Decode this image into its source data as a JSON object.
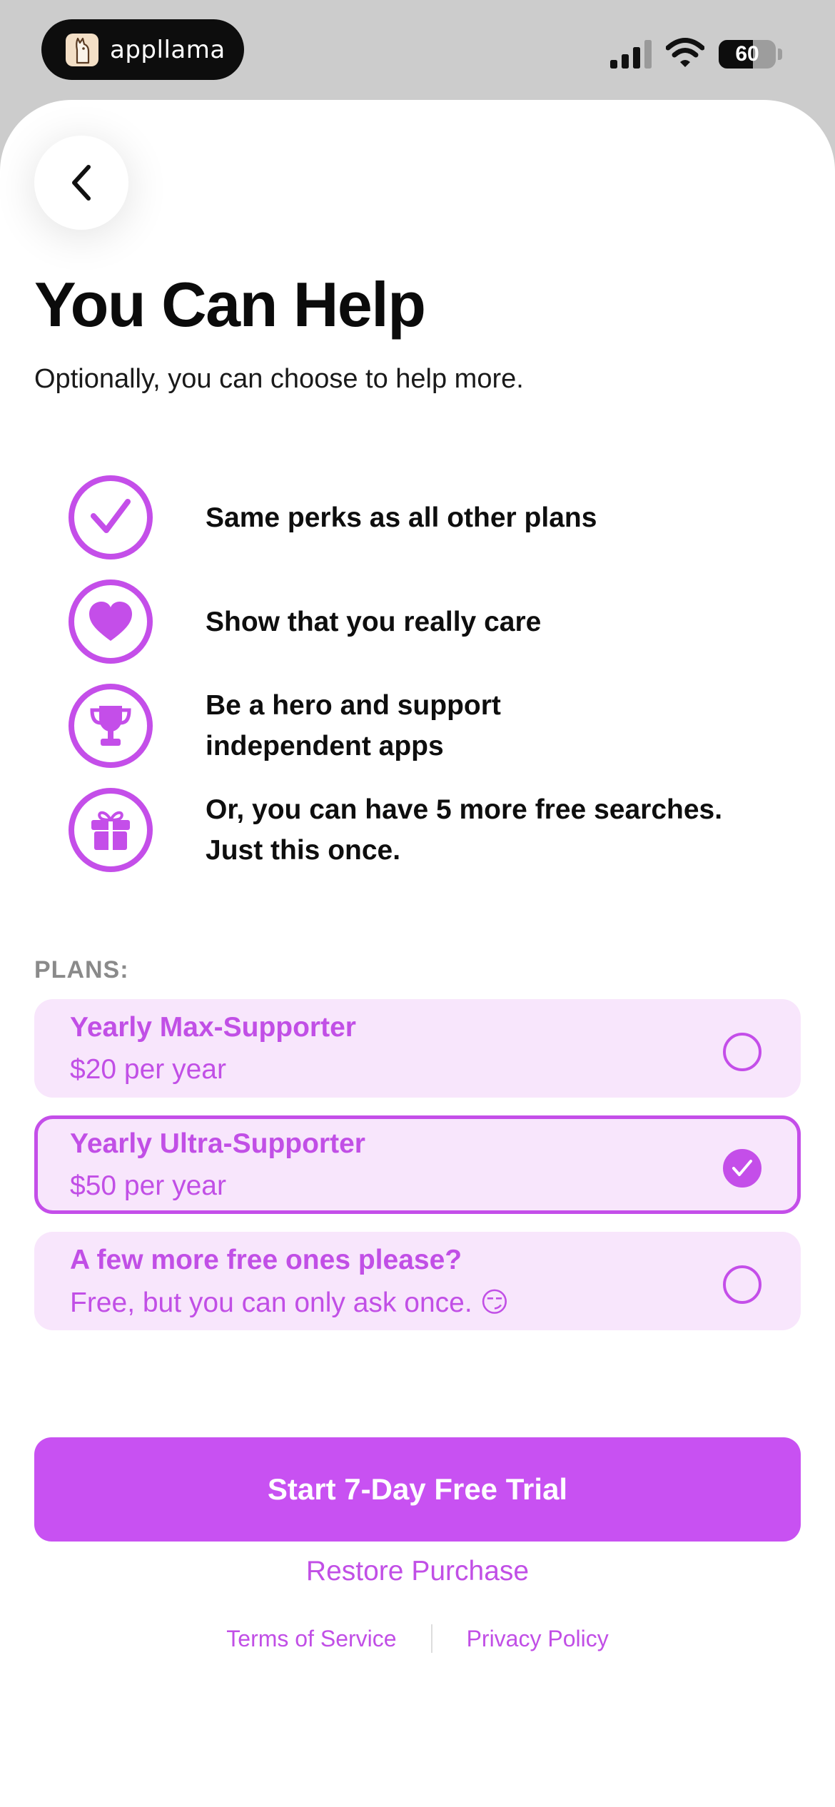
{
  "status_bar": {
    "app_name": "appllama",
    "battery_percent": 60,
    "battery_text": "60"
  },
  "header": {
    "back_icon": "chevron-left-icon",
    "title": "You Can Help",
    "subtitle": "Optionally, you can choose to help more."
  },
  "perks": [
    {
      "icon": "checkmark-icon",
      "text": "Same perks as all other plans"
    },
    {
      "icon": "heart-icon",
      "text": "Show that you really care"
    },
    {
      "icon": "trophy-icon",
      "text": "Be a hero and support\nindependent apps"
    },
    {
      "icon": "gift-icon",
      "text": "Or, you can have 5 more free searches.\nJust this once."
    }
  ],
  "plans_label": "PLANS:",
  "plans": [
    {
      "name": "Yearly Max-Supporter",
      "price": "$20 per year",
      "selected": false
    },
    {
      "name": "Yearly Ultra-Supporter",
      "price": "$50 per year",
      "selected": true
    },
    {
      "name": "A few more free ones please?",
      "price": "Free, but you can only ask once. 😏",
      "selected": false
    }
  ],
  "cta_label": "Start 7-Day Free Trial",
  "restore_label": "Restore Purchase",
  "footer": {
    "terms": "Terms of Service",
    "privacy": "Privacy Policy"
  },
  "colors": {
    "accent": "#c851f2",
    "accent_text": "#c14fe6",
    "plan_bg": "#f8e6fc"
  }
}
